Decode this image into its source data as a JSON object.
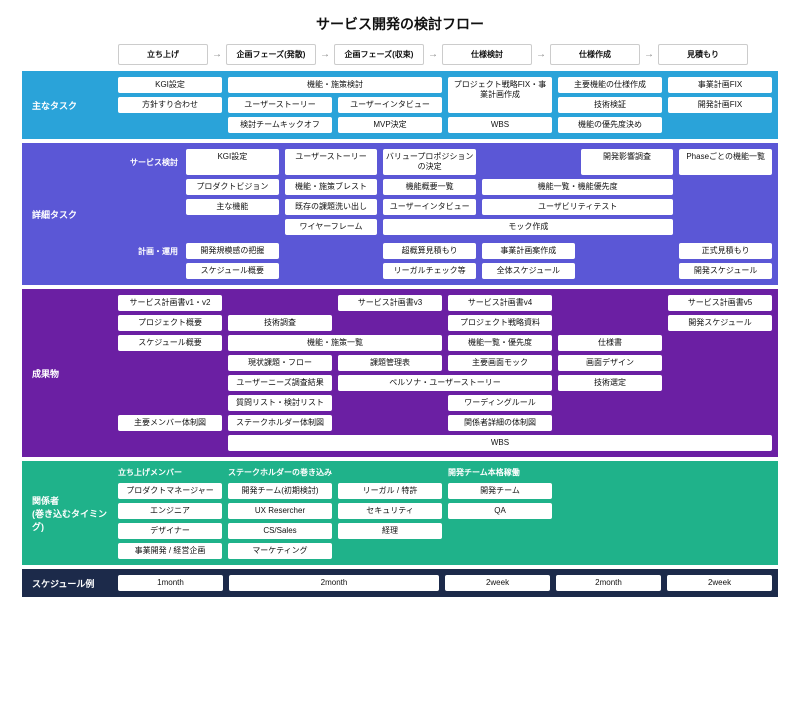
{
  "title": "サービス開発の検討フロー",
  "phases": [
    "立ち上げ",
    "企画フェーズ(発散)",
    "企画フェーズ(収束)",
    "仕様検討",
    "仕様作成",
    "見積もり"
  ],
  "s1": {
    "label": "主なタスク",
    "col1": [
      "KGI設定",
      "方針すり合わせ"
    ],
    "col2_top": "機能・施策検討",
    "col2": [
      "ユーザーストーリー",
      "検討チームキックオフ"
    ],
    "col3": [
      "ユーザーインタビュー",
      "MVP決定"
    ],
    "col4": [
      "プロジェクト戦略FIX・事業計画作成",
      "WBS"
    ],
    "col5": [
      "主要機能の仕様作成",
      "技術検証",
      "機能の優先度決め"
    ],
    "col6": [
      "事業計画FIX",
      "開発計画FIX"
    ]
  },
  "s2": {
    "label": "詳細タスク",
    "subA": "サービス検討",
    "subB": "計画・運用",
    "a_col1": [
      "KGI設定",
      "プロダクトビジョン",
      "主な機能"
    ],
    "a_col2": [
      "ユーザーストーリー",
      "機能・施策ブレスト",
      "既存の課題洗い出し",
      "ワイヤーフレーム"
    ],
    "a_col3": [
      "バリュープロポジションの決定",
      "機能概要一覧",
      "ユーザーインタビュー"
    ],
    "a_col4_pair": "機能一覧・機能優先度",
    "a_col5": "開発影響調査",
    "a_col6": "Phaseごとの機能一覧",
    "a_usability": "ユーザビリティテスト",
    "a_mock": "モック作成",
    "b_col1": [
      "開発規模感の把握",
      "スケジュール概要"
    ],
    "b_col3": [
      "超概算見積もり",
      "リーガルチェック等"
    ],
    "b_col4": [
      "事業計画案作成",
      "全体スケジュール"
    ],
    "b_col6": [
      "正式見積もり",
      "開発スケジュール"
    ]
  },
  "s3": {
    "label": "成果物",
    "col1": [
      "サービス計画書v1・v2",
      "プロジェクト概要",
      "スケジュール概要"
    ],
    "col1_last": "主要メンバー体制図",
    "col2": [
      "技術調査",
      "現状課題・フロー",
      "ユーザーニーズ調査結果",
      "質問リスト・検討リスト",
      "ステークホルダー体制図"
    ],
    "col23_top": "機能・施策一覧",
    "col3_top": "サービス計画書v3",
    "col3": [
      "課題管理表"
    ],
    "col34_persona": "ペルソナ・ユーザーストーリー",
    "col4": [
      "サービス計画書v4",
      "プロジェクト戦略資料",
      "機能一覧・優先度",
      "主要画面モック",
      "ワーディングルール",
      "関係者詳細の体制図"
    ],
    "col5": [
      "仕様書",
      "画面デザイン",
      "技術選定"
    ],
    "col6": [
      "サービス計画書v5",
      "開発スケジュール"
    ],
    "wbs": "WBS"
  },
  "s4": {
    "label": "関係者\n(巻き込むタイミング)",
    "g1_title": "立ち上げメンバー",
    "g1": [
      "プロダクトマネージャー",
      "エンジニア",
      "デザイナー",
      "事業開発 / 経営企画"
    ],
    "g2_title": "ステークホルダーの巻き込み",
    "g2a": [
      "開発チーム(初期検討)",
      "UX Resercher",
      "CS/Sales",
      "マーケティング"
    ],
    "g2b": [
      "リーガル / 特許",
      "セキュリティ",
      "経理"
    ],
    "g3_title": "開発チーム本格稼働",
    "g3": [
      "開発チーム",
      "QA"
    ]
  },
  "s5": {
    "label": "スケジュール例",
    "items": [
      "1month",
      "2month",
      "2week",
      "2month",
      "2week"
    ]
  }
}
